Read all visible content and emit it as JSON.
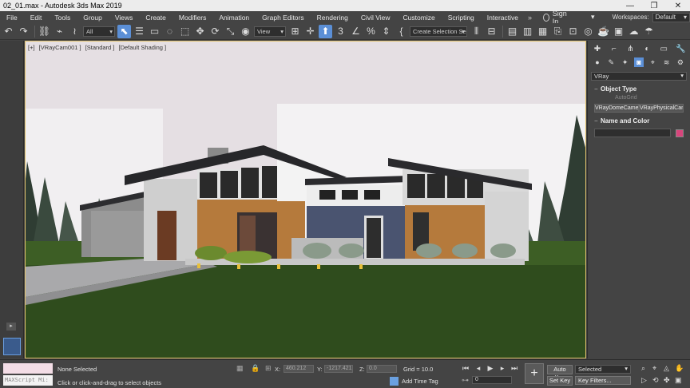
{
  "window": {
    "title": "02_01.max - Autodesk 3ds Max 2019",
    "minimize_glyph": "—",
    "maximize_glyph": "❐",
    "close_glyph": "✕"
  },
  "menu": {
    "items": [
      "File",
      "Edit",
      "Tools",
      "Group",
      "Views",
      "Create",
      "Modifiers",
      "Animation",
      "Graph Editors",
      "Rendering",
      "Civil View",
      "Customize",
      "Scripting",
      "Interactive"
    ],
    "more_glyph": "»",
    "sign_in": "Sign In",
    "workspaces_label": "Workspaces:",
    "workspaces_value": "Default"
  },
  "toolbar": {
    "selection_filter": "All",
    "reference_coord": "View",
    "named_selection_set": "Create Selection Se"
  },
  "viewport": {
    "label_plus": "[+]",
    "label_camera": "[VRayCam001 ]",
    "label_standard": "[Standard ]",
    "label_shading": "[Default Shading ]"
  },
  "command_panel": {
    "renderer_category": "VRay",
    "object_type_title": "Object Type",
    "autogrid_label": "AutoGrid",
    "dome_camera_button": "VRayDomeCame",
    "physical_camera_button": "VRayPhysicalCam",
    "name_and_color_title": "Name and Color",
    "object_color": "#d8457c"
  },
  "status": {
    "maxscript_listener": "MAXScript Mi:",
    "selection_info": "None Selected",
    "prompt": "Click or click-and-drag to select objects",
    "x_label": "X:",
    "x_value": "460.212",
    "y_label": "Y:",
    "y_value": "-1217.421",
    "z_label": "Z:",
    "z_value": "0.0",
    "grid": "Grid = 10.0",
    "add_time_tag": "Add Time Tag",
    "frame_value": "0",
    "auto_key": "Auto Key",
    "set_key": "Set Key",
    "selected_set": "Selected",
    "key_filters": "Key Filters..."
  },
  "icons": {
    "undo": "undo-icon",
    "redo": "redo-icon",
    "link": "link-icon",
    "unlink": "unlink-icon",
    "select": "select-object-icon",
    "move": "move-icon",
    "rotate": "rotate-icon",
    "scale": "scale-icon",
    "render": "render-icon",
    "camera": "camera-icon"
  }
}
